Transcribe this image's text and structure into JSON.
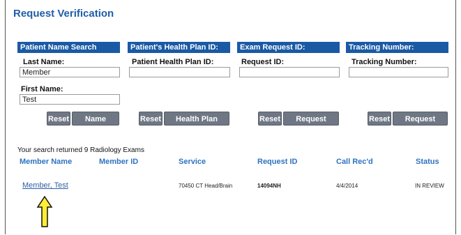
{
  "page": {
    "title": "Request Verification"
  },
  "panels": [
    {
      "header": "Patient Name Search"
    },
    {
      "header": "Patient's Health Plan ID:"
    },
    {
      "header": "Exam Request ID:"
    },
    {
      "header": "Tracking Number:"
    }
  ],
  "fields": {
    "last_name": {
      "label": "Last Name:",
      "value": "Member"
    },
    "first_name": {
      "label": "First Name:",
      "value": "Test"
    },
    "health_plan_id": {
      "label": "Patient Health Plan ID:",
      "value": ""
    },
    "request_id": {
      "label": "Request ID:",
      "value": ""
    },
    "tracking_number": {
      "label": "Tracking Number:",
      "value": ""
    }
  },
  "buttons": {
    "reset": "Reset",
    "name_search": "Name Search",
    "health_plan_search": "Health Plan Search",
    "request_search": "Request Search"
  },
  "results": {
    "summary": "Your search returned 9 Radiology Exams",
    "columns": [
      "Member Name",
      "Member ID",
      "Service",
      "Request ID",
      "Call Rec'd",
      "Status"
    ],
    "rows": [
      {
        "member_name": "Member, Test",
        "member_id": "",
        "service": "70450 CT Head/Brain",
        "request_id": "14094NH",
        "call_recd": "4/4/2014",
        "status": "IN REVIEW"
      }
    ]
  },
  "colors": {
    "header_blue": "#1a5aa5",
    "link_blue": "#2f73bf",
    "button_gray": "#6f7784",
    "arrow_yellow": "#ffee33"
  },
  "icons": {
    "pointer_arrow": "up-arrow-icon"
  }
}
